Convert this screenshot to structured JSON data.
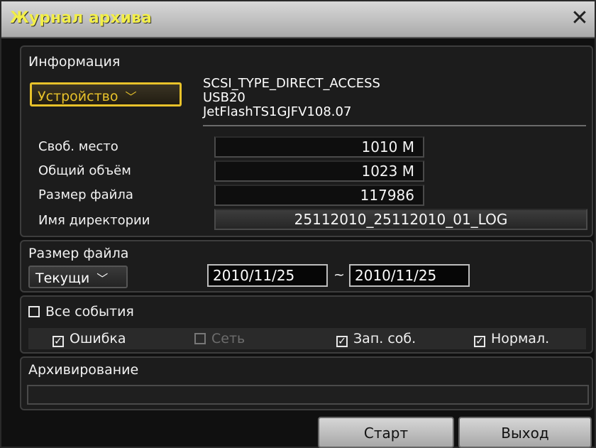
{
  "window": {
    "title": "Журнал архива"
  },
  "info": {
    "section_label": "Информация",
    "device_dropdown": "Устройство",
    "device_lines": [
      "SCSI_TYPE_DIRECT_ACCESS",
      "USB20",
      "JetFlashTS1GJFV108.07"
    ],
    "free_space_label": "Своб. место",
    "free_space_value": "1010 M",
    "total_label": "Общий объём",
    "total_value": "1023 M",
    "filesize_label": "Размер файла",
    "filesize_value": "117986",
    "dir_label": "Имя директории",
    "dir_value": "25112010_25112010_01_LOG"
  },
  "range": {
    "section_label": "Размер файла",
    "mode_dropdown": "Текущи",
    "date_from": "2010/11/25",
    "separator": "~",
    "date_to": "2010/11/25"
  },
  "events": {
    "all_label": "Все события",
    "all_checked": false,
    "items": [
      {
        "label": "Ошибка",
        "checked": true,
        "enabled": true
      },
      {
        "label": "Сеть",
        "checked": false,
        "enabled": false
      },
      {
        "label": "Зап. соб.",
        "checked": true,
        "enabled": true
      },
      {
        "label": "Нормал.",
        "checked": true,
        "enabled": true
      }
    ]
  },
  "archive": {
    "section_label": "Архивирование",
    "progress": 0
  },
  "buttons": {
    "start": "Старт",
    "exit": "Выход"
  },
  "icons": {
    "close": "close-icon",
    "chevron": "chevron-down-icon",
    "check": "check-icon"
  },
  "colors": {
    "title_yellow": "#f2ee4a",
    "dropdown_highlight": "#e8c22a"
  }
}
